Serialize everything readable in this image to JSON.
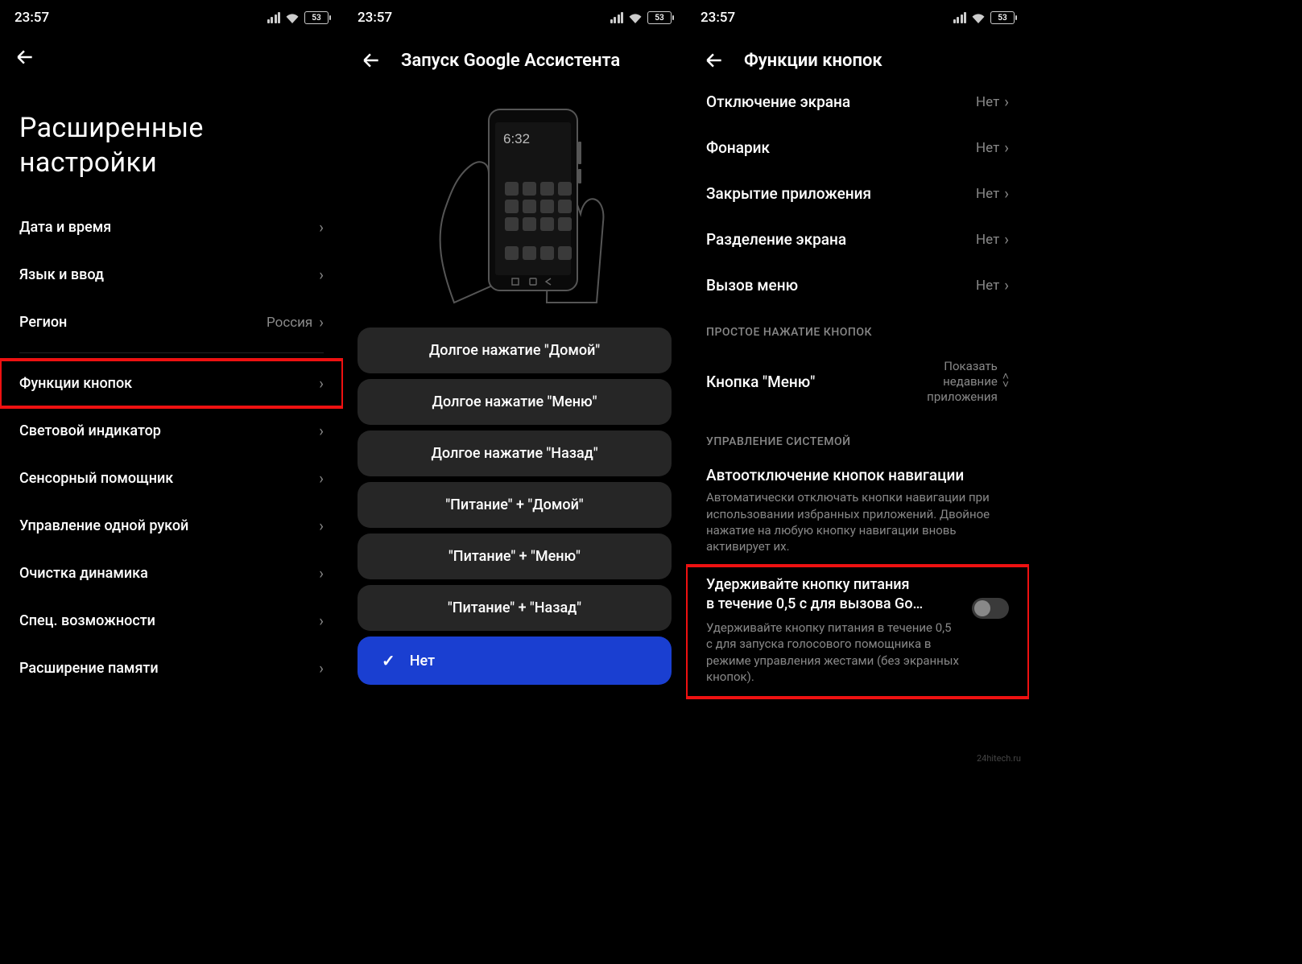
{
  "status": {
    "time": "23:57",
    "battery": "53"
  },
  "p1": {
    "title_line1": "Расширенные",
    "title_line2": "настройки",
    "rows": [
      {
        "label": "Дата и время",
        "value": ""
      },
      {
        "label": "Язык и ввод",
        "value": ""
      },
      {
        "label": "Регион",
        "value": "Россия"
      }
    ],
    "highlight": {
      "label": "Функции кнопок"
    },
    "rows2": [
      {
        "label": "Световой индикатор"
      },
      {
        "label": "Сенсорный помощник"
      },
      {
        "label": "Управление одной рукой"
      },
      {
        "label": "Очистка динамика"
      },
      {
        "label": "Спец. возможности"
      },
      {
        "label": "Расширение памяти"
      }
    ]
  },
  "p2": {
    "title": "Запуск Google Ассистента",
    "phone_time": "6:32",
    "options": [
      "Долгое нажатие \"Домой\"",
      "Долгое нажатие \"Меню\"",
      "Долгое нажатие \"Назад\"",
      "\"Питание\" + \"Домой\"",
      "\"Питание\" + \"Меню\"",
      "\"Питание\" + \"Назад\""
    ],
    "selected": "Нет"
  },
  "p3": {
    "title": "Функции кнопок",
    "rows": [
      {
        "label": "Отключение экрана",
        "value": "Нет"
      },
      {
        "label": "Фонарик",
        "value": "Нет"
      },
      {
        "label": "Закрытие приложения",
        "value": "Нет"
      },
      {
        "label": "Разделение экрана",
        "value": "Нет"
      },
      {
        "label": "Вызов меню",
        "value": "Нет"
      }
    ],
    "section1": "ПРОСТОЕ НАЖАТИЕ КНОПОК",
    "menu_btn": {
      "label": "Кнопка \"Меню\"",
      "value": "Показать\nнедавние\nприложения"
    },
    "section2": "УПРАВЛЕНИЕ СИСТЕМОЙ",
    "auto": {
      "title": "Автоотключение кнопок навигации",
      "desc": "Автоматически отключать кнопки навигации при использовании избранных приложений. Двойное нажатие на любую кнопку навигации вновь активирует их."
    },
    "hold": {
      "title_l1": "Удерживайте кнопку питания",
      "title_l2": "в течение 0,5 с для вызова Go…",
      "desc": "Удерживайте кнопку питания в течение 0,5 с для запуска голосового помощника в режиме управления жестами (без экранных кнопок)."
    }
  },
  "watermark": "24hitech.ru"
}
